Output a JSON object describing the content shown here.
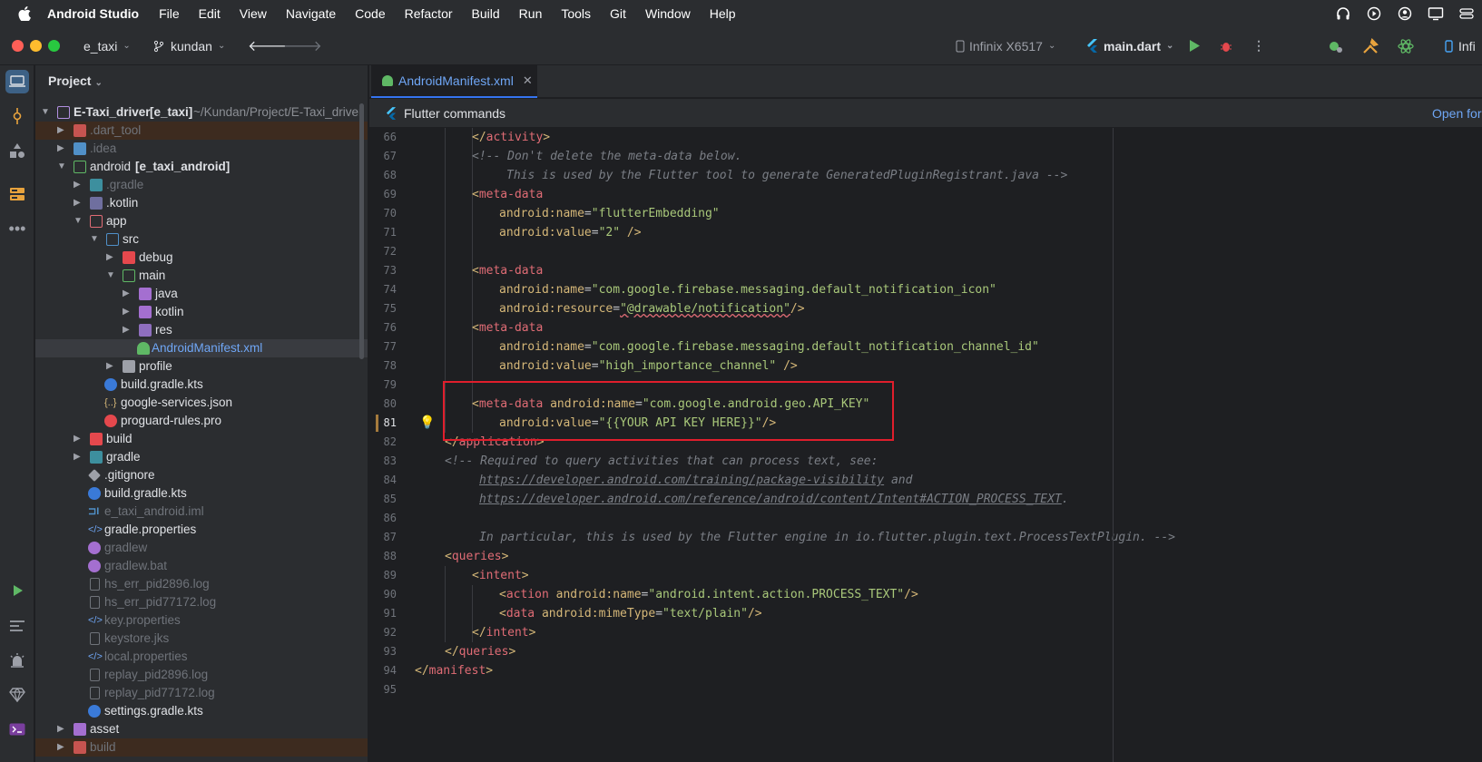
{
  "menubar": {
    "app_name": "Android Studio",
    "items": [
      "File",
      "Edit",
      "View",
      "Navigate",
      "Code",
      "Refactor",
      "Build",
      "Run",
      "Tools",
      "Git",
      "Window",
      "Help"
    ],
    "right_icons": [
      "headphones-icon",
      "play-circle-icon",
      "user-circle-icon",
      "display-icon",
      "control-center-icon"
    ]
  },
  "toolbar": {
    "project": "e_taxi",
    "branch": "kundan",
    "device": "Infinix X6517",
    "run_config": "main.dart",
    "right_label": "Infi"
  },
  "project_panel": {
    "title": "Project",
    "rows": [
      {
        "label": "E-Taxi_driver",
        "bold_suffix": "[e_taxi]",
        "path": "~/Kundan/Project/E-Taxi_driver"
      },
      {
        "label": ".dart_tool"
      },
      {
        "label": ".idea"
      },
      {
        "label": "android",
        "bold_suffix": "[e_taxi_android]"
      },
      {
        "label": ".gradle"
      },
      {
        "label": ".kotlin"
      },
      {
        "label": "app"
      },
      {
        "label": "src"
      },
      {
        "label": "debug"
      },
      {
        "label": "main"
      },
      {
        "label": "java"
      },
      {
        "label": "kotlin"
      },
      {
        "label": "res"
      },
      {
        "label": "AndroidManifest.xml"
      },
      {
        "label": "profile"
      },
      {
        "label": "build.gradle.kts"
      },
      {
        "label": "google-services.json"
      },
      {
        "label": "proguard-rules.pro"
      },
      {
        "label": "build"
      },
      {
        "label": "gradle"
      },
      {
        "label": ".gitignore"
      },
      {
        "label": "build.gradle.kts"
      },
      {
        "label": "e_taxi_android.iml"
      },
      {
        "label": "gradle.properties"
      },
      {
        "label": "gradlew"
      },
      {
        "label": "gradlew.bat"
      },
      {
        "label": "hs_err_pid2896.log"
      },
      {
        "label": "hs_err_pid77172.log"
      },
      {
        "label": "key.properties"
      },
      {
        "label": "keystore.jks"
      },
      {
        "label": "local.properties"
      },
      {
        "label": "replay_pid2896.log"
      },
      {
        "label": "replay_pid77172.log"
      },
      {
        "label": "settings.gradle.kts"
      },
      {
        "label": "asset"
      },
      {
        "label": "build"
      }
    ]
  },
  "editor": {
    "tab_label": "AndroidManifest.xml",
    "commands_label": "Flutter commands",
    "open_for_label": "Open for",
    "line_numbers": [
      "66",
      "67",
      "68",
      "69",
      "70",
      "71",
      "72",
      "73",
      "74",
      "75",
      "76",
      "77",
      "78",
      "79",
      "80",
      "81",
      "82",
      "83",
      "84",
      "85",
      "86",
      "87",
      "88",
      "89",
      "90",
      "91",
      "92",
      "93",
      "94",
      "95"
    ],
    "code": {
      "l66_tag": "activity",
      "l67": "<!-- Don't delete the meta-data below.",
      "l68": "This is used by the Flutter tool to generate GeneratedPluginRegistrant.java -->",
      "meta_data": "meta-data",
      "a_name": "android:name",
      "a_value": "android:value",
      "a_resource": "android:resource",
      "a_mime": "android:mimeType",
      "v70": "\"flutterEmbedding\"",
      "v71": "\"2\"",
      "v74": "\"com.google.firebase.messaging.default_notification_icon\"",
      "v75": "\"@drawable/notification\"",
      "v77": "\"com.google.firebase.messaging.default_notification_channel_id\"",
      "v78": "\"high_importance_channel\"",
      "v80": "\"com.google.android.geo.API_KEY\"",
      "v81": "\"{{YOUR API KEY HERE}}\"",
      "application": "application",
      "l83": "<!-- Required to query activities that can process text, see:",
      "l84_link": "https://developer.android.com/training/package-visibility",
      "l84_tail": " and",
      "l85_link": "https://developer.android.com/reference/android/content/Intent#ACTION_PROCESS_TEXT",
      "l85_tail": ".",
      "l87": "In particular, this is used by the Flutter engine in io.flutter.plugin.text.ProcessTextPlugin. -->",
      "queries": "queries",
      "intent": "intent",
      "action": "action",
      "data_tag": "data",
      "v90": "\"android.intent.action.PROCESS_TEXT\"",
      "v91": "\"text/plain\"",
      "manifest": "manifest"
    }
  }
}
